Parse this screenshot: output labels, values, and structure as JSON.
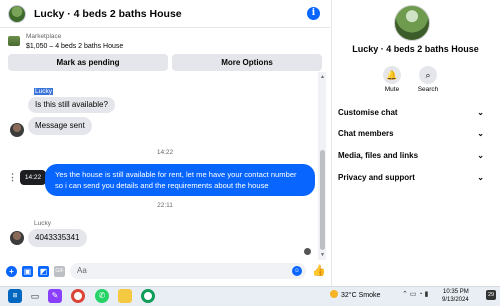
{
  "header": {
    "title": "Lucky · 4 beds 2 baths House",
    "info_icon": "info-icon"
  },
  "marketplace": {
    "label": "Marketplace",
    "listing": "$1,050 – 4 beds 2 baths House"
  },
  "actions": {
    "mark_pending": "Mark as pending",
    "more_options": "More Options"
  },
  "messages": {
    "sender_name_1": "Lucky",
    "msg_1": "Is this still available?",
    "msg_2": "Message sent",
    "timestamp_1": "14:22",
    "out_msg": "Yes the house is still available for rent, let me have your contact number so i can send you details and the requirements about the house",
    "tooltip_time": "14:22",
    "timestamp_2": "22:11",
    "sender_name_2": "Lucky",
    "msg_3": "4043335341"
  },
  "composer": {
    "placeholder": "Aa"
  },
  "panel": {
    "title": "Lucky · 4 beds 2 baths House",
    "mute_label": "Mute",
    "search_label": "Search",
    "items": [
      {
        "label": "Customise chat"
      },
      {
        "label": "Chat members"
      },
      {
        "label": "Media, files and links"
      },
      {
        "label": "Privacy and support"
      }
    ]
  },
  "taskbar": {
    "weather": "32°C  Smoke",
    "time": "10:35 PM",
    "date": "9/13/2024",
    "notif_count": "29"
  },
  "colors": {
    "accent": "#0866ff",
    "bubble_in": "#e4e6eb"
  }
}
